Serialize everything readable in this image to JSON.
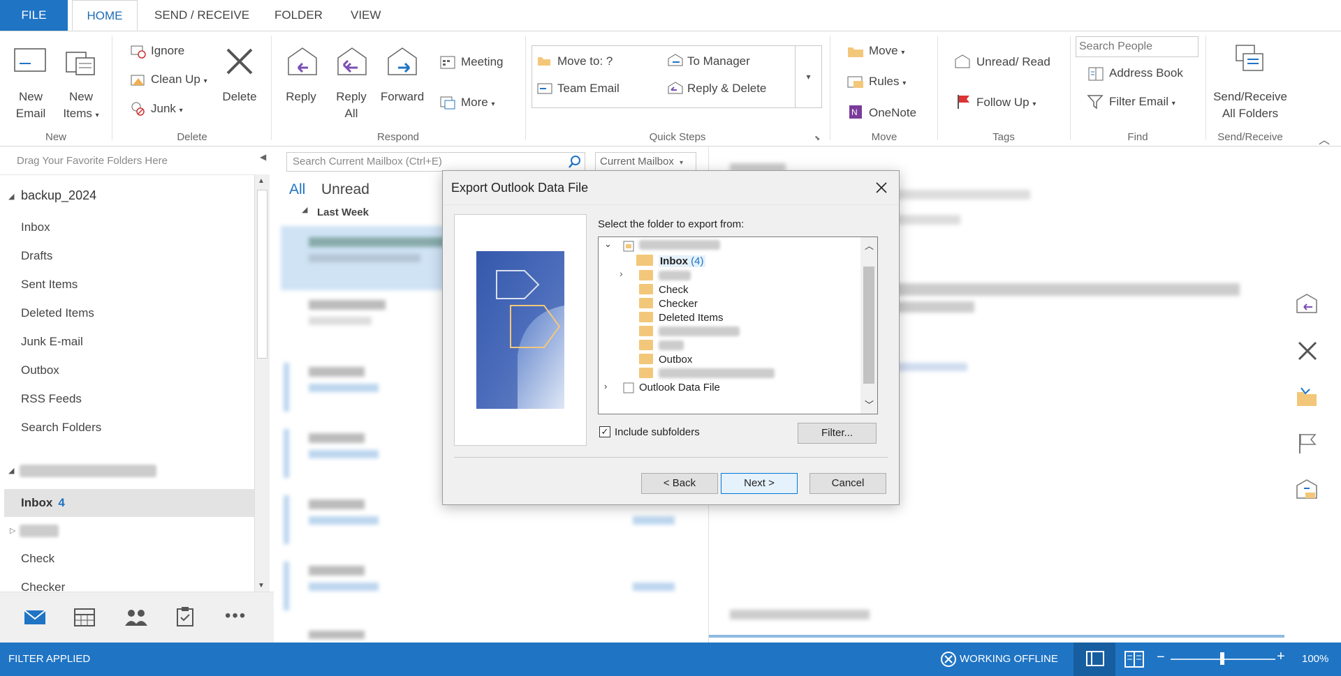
{
  "tabs": [
    "FILE",
    "HOME",
    "SEND / RECEIVE",
    "FOLDER",
    "VIEW"
  ],
  "ribbon": {
    "new": {
      "new_email": [
        "New",
        "Email"
      ],
      "new_items": [
        "New",
        "Items"
      ],
      "group": "New"
    },
    "delete": {
      "ignore": "Ignore",
      "clean_up": "Clean Up",
      "junk": "Junk",
      "delete": "Delete",
      "group": "Delete"
    },
    "respond": {
      "reply": "Reply",
      "reply_all": [
        "Reply",
        "All"
      ],
      "forward": "Forward",
      "meeting": "Meeting",
      "more": "More",
      "group": "Respond"
    },
    "quick_steps": {
      "move_to": "Move to: ?",
      "to_manager": "To Manager",
      "team_email": "Team Email",
      "reply_delete": "Reply & Delete",
      "group": "Quick Steps"
    },
    "move": {
      "move": "Move",
      "rules": "Rules",
      "onenote": "OneNote",
      "group": "Move"
    },
    "tags": {
      "unread_read": "Unread/ Read",
      "follow_up": "Follow Up",
      "group": "Tags"
    },
    "find": {
      "search_people": "Search People",
      "address_book": "Address Book",
      "filter_email": "Filter Email",
      "group": "Find"
    },
    "send_receive": {
      "label": [
        "Send/Receive",
        "All Folders"
      ],
      "group": "Send/Receive"
    }
  },
  "left_pane": {
    "favorites_hint": "Drag Your Favorite Folders Here",
    "account1": "backup_2024",
    "folders1": [
      "Inbox",
      "Drafts",
      "Sent Items",
      "Deleted Items",
      "Junk E-mail",
      "Outbox",
      "RSS Feeds",
      "Search Folders"
    ],
    "account2_folders": [
      {
        "label": "Inbox",
        "count": "4"
      },
      {
        "label": "Check"
      },
      {
        "label": "Checker"
      }
    ]
  },
  "message_list": {
    "search_placeholder": "Search Current Mailbox (Ctrl+E)",
    "scope": "Current Mailbox",
    "filter_all": "All",
    "filter_unread": "Unread",
    "group_header": "Last Week"
  },
  "dialog": {
    "title": "Export Outlook Data File",
    "prompt": "Select the folder to export from:",
    "tree": [
      {
        "label": "Inbox",
        "count": "(4)"
      },
      {
        "label": "Check"
      },
      {
        "label": "Checker"
      },
      {
        "label": "Deleted Items"
      },
      {
        "label": "Outbox"
      },
      {
        "label": "Outlook Data File"
      }
    ],
    "include_subfolders": "Include subfolders",
    "filter_button": "Filter...",
    "back_button": "< Back",
    "next_button": "Next >",
    "cancel_button": "Cancel"
  },
  "status_bar": {
    "left": "FILTER APPLIED",
    "offline": "WORKING OFFLINE",
    "zoom": "100%"
  },
  "colors": {
    "accent": "#1f74c4",
    "tab_active_text": "#1f6cb5",
    "folder_yellow": "#f3c77a"
  }
}
